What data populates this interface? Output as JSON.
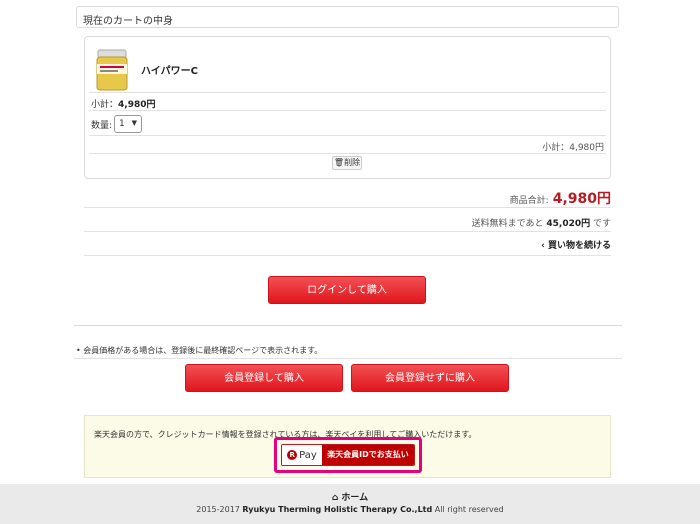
{
  "cart": {
    "title": "現在のカートの中身",
    "item": {
      "name": "ハイパワーC",
      "subtotal_label": "小計：",
      "subtotal_value": "4,980円",
      "qty_label": "数量:",
      "qty_value": "1",
      "subtotal_right": "小計：4,980円",
      "delete_label": "削除"
    }
  },
  "summary": {
    "total_label": "商品合計:",
    "total_value": "4,980円",
    "free_ship_prefix": "送料無料まであと",
    "free_ship_amount": "45,020円",
    "free_ship_suffix": "です",
    "continue_label": "買い物を続ける"
  },
  "buttons": {
    "login_buy": "ログインして購入",
    "register_buy": "会員登録して購入",
    "no_register_buy": "会員登録せずに購入"
  },
  "note": "会員価格がある場合は、登録後に最終確認ページで表示されます。",
  "rakuten": {
    "text": "楽天会員の方で、クレジットカード情報を登録されている方は、楽天ペイを利用してご購入いただけます。",
    "logo_letter": "R",
    "logo_word": "Pay",
    "button_label": "楽天会員IDでお支払い"
  },
  "footer": {
    "home": "ホーム",
    "copyright_years": "2015-2017",
    "company": "Ryukyu Therming Holistic Therapy Co.,Ltd",
    "rights": "All right reserved"
  },
  "colors": {
    "accent_red": "#e0161c",
    "price_red": "#b81c22",
    "rpay_highlight": "#e6007e"
  }
}
